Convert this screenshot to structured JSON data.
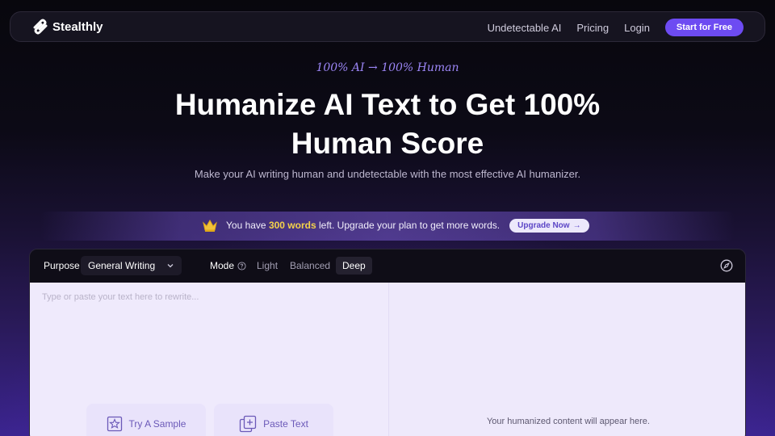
{
  "nav": {
    "brand": "Stealthly",
    "links": [
      "Undetectable AI",
      "Pricing",
      "Login"
    ],
    "cta": "Start for Free"
  },
  "hero": {
    "tagline": "100% AI → 100% Human",
    "title_line1": "Humanize AI Text to Get 100%",
    "title_line2": "Human Score",
    "subtitle": "Make your AI writing human and undetectable with the most effective AI humanizer."
  },
  "promo": {
    "text_before": "You have",
    "words": "300 words",
    "text_after": "left. Upgrade your plan to get more words.",
    "button": "Upgrade Now",
    "button_arrow": "→",
    "accent": "#f4d24a"
  },
  "editor": {
    "purpose_label": "Purpose",
    "purpose_value": "General Writing",
    "mode_label": "Mode",
    "modes": [
      "Light",
      "Balanced",
      "Deep"
    ],
    "active_mode": "Deep",
    "input_placeholder": "Type or paste your text here to rewrite...",
    "try_sample": "Try A Sample",
    "paste_text": "Paste Text",
    "output_placeholder": "Your humanized content will appear here."
  },
  "colors": {
    "accent": "#6d4bf2",
    "background": "#07060c"
  }
}
